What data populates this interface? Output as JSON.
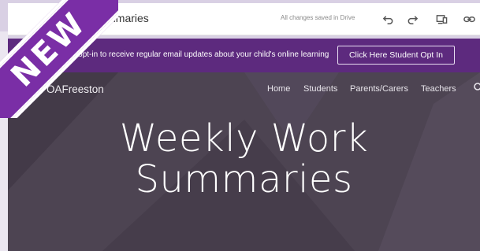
{
  "ribbon": {
    "label": "NEW"
  },
  "toolbar": {
    "title": "Summaries",
    "save_status": "All changes saved in Drive",
    "icons": [
      "undo-icon",
      "redo-icon",
      "preview-icon",
      "link-icon"
    ]
  },
  "banner": {
    "text": "hoose to opt-in to receive regular email updates about your child's online learning",
    "button_label": "Click Here Student Opt In"
  },
  "site": {
    "name": "OAFreeston",
    "nav": [
      "Home",
      "Students",
      "Parents/Carers",
      "Teachers"
    ]
  },
  "hero": {
    "line1": "Weekly Work",
    "line2": "Summaries"
  },
  "colors": {
    "ribbon": "#7a2ea6",
    "banner": "#5d2a7e",
    "hero_bg": "#4d4452"
  }
}
